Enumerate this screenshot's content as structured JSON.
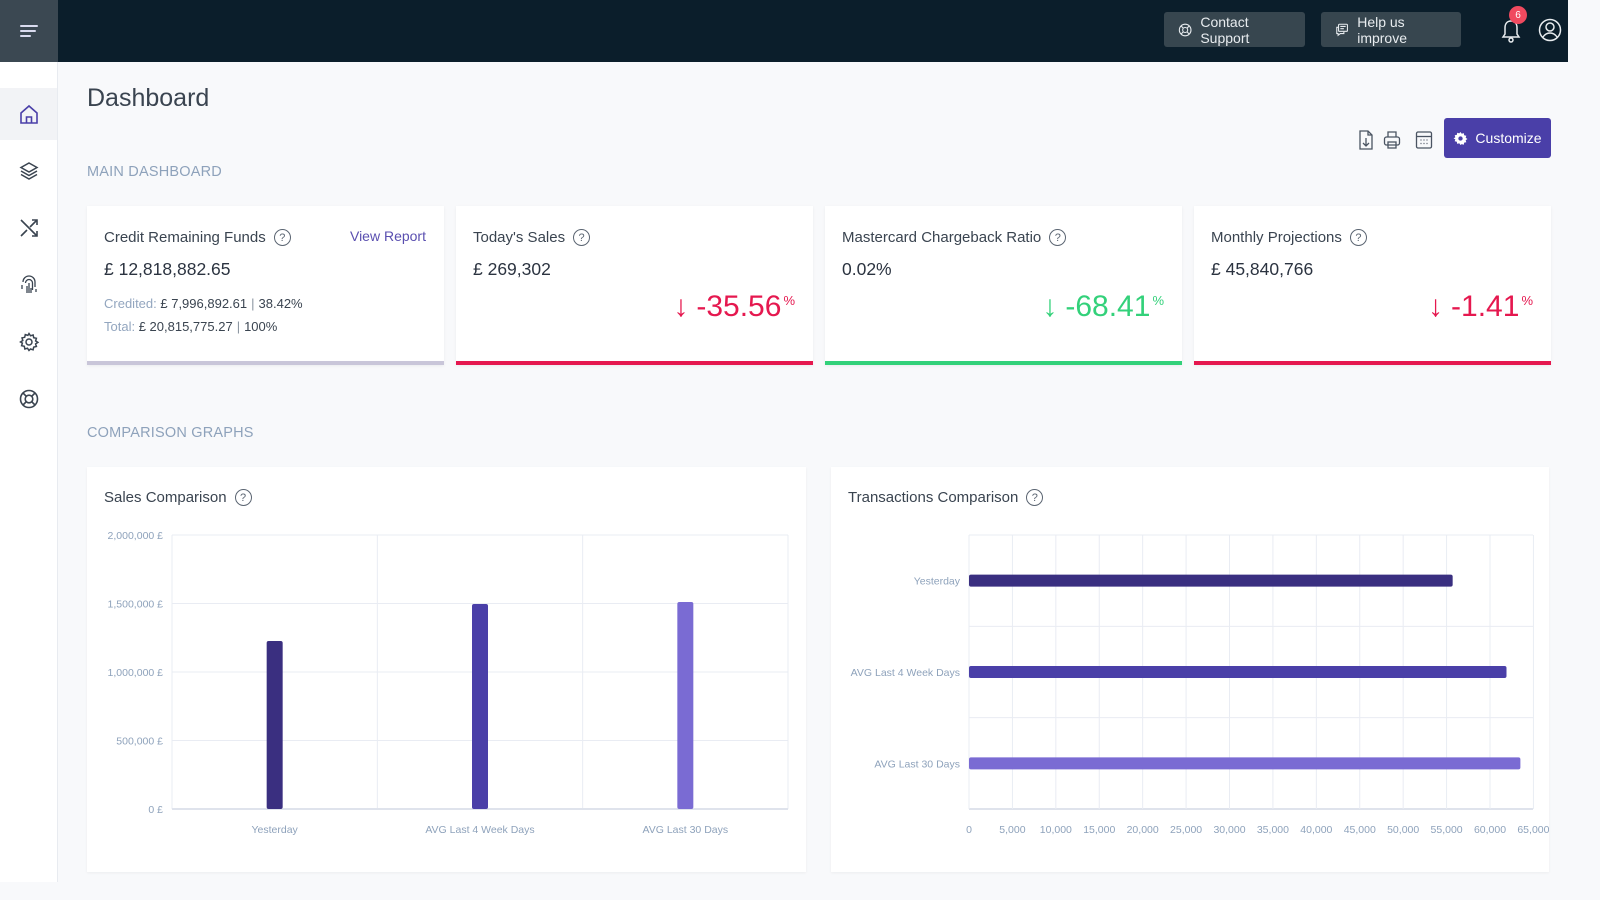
{
  "topbar": {
    "menu_icon": "hamburger-icon",
    "contact_support": "Contact Support",
    "help_improve": "Help us improve",
    "notifications_count": "6"
  },
  "sidebar": {
    "items": [
      {
        "name": "home",
        "icon": "home-icon",
        "active": true
      },
      {
        "name": "layers",
        "icon": "layers-icon"
      },
      {
        "name": "transactions",
        "icon": "shuffle-icon"
      },
      {
        "name": "security",
        "icon": "fingerprint-icon"
      },
      {
        "name": "settings",
        "icon": "gear-icon"
      },
      {
        "name": "support",
        "icon": "lifebuoy-icon"
      }
    ]
  },
  "page": {
    "title": "Dashboard",
    "main_section": "MAIN DASHBOARD",
    "comparison_section": "COMPARISON GRAPHS",
    "customize": "Customize"
  },
  "colors": {
    "accent": "#4a3fa8",
    "negative": "#e5184f",
    "positive": "#33d17a",
    "neutral_bar": "#c9c6d9"
  },
  "kpis": [
    {
      "title": "Credit Remaining Funds",
      "value": "£ 12,818,882.65",
      "link": "View Report",
      "credited_label": "Credited:",
      "credited_value": "£ 7,996,892.61",
      "credited_pct": "38.42%",
      "total_label": "Total:",
      "total_value": "£ 20,815,775.27",
      "total_pct": "100%"
    },
    {
      "title": "Today's Sales",
      "value": "£ 269,302",
      "delta": "-35.56",
      "delta_unit": "%",
      "arrow": "↓",
      "status": "negative"
    },
    {
      "title": "Mastercard Chargeback Ratio",
      "value": "0.02%",
      "delta": "-68.41",
      "delta_unit": "%",
      "arrow": "↓",
      "status": "positive"
    },
    {
      "title": "Monthly Projections",
      "value": "£ 45,840,766",
      "delta": "-1.41",
      "delta_unit": "%",
      "arrow": "↓",
      "status": "negative"
    }
  ],
  "chart_data": [
    {
      "type": "bar",
      "title": "Sales Comparison",
      "orientation": "vertical",
      "categories": [
        "Yesterday",
        "AVG Last 4 Week Days",
        "AVG Last 30 Days"
      ],
      "values": [
        1226000,
        1496000,
        1511000
      ],
      "colors": [
        "#3a2f80",
        "#4a3fa8",
        "#7a6bd3"
      ],
      "yticks": [
        "0 £",
        "500,000 £",
        "1,000,000 £",
        "1,500,000 £",
        "2,000,000 £"
      ],
      "ylim": [
        0,
        2000000
      ],
      "grid": true
    },
    {
      "type": "bar",
      "title": "Transactions Comparison",
      "orientation": "horizontal",
      "categories": [
        "Yesterday",
        "AVG Last 4 Week Days",
        "AVG Last 30 Days"
      ],
      "values": [
        55700,
        61900,
        63500
      ],
      "colors": [
        "#3a2f80",
        "#4a3fa8",
        "#7a6bd3"
      ],
      "xticks": [
        "0",
        "5,000",
        "10,000",
        "15,000",
        "20,000",
        "25,000",
        "30,000",
        "35,000",
        "40,000",
        "45,000",
        "50,000",
        "55,000",
        "60,000",
        "65,000"
      ],
      "xlim": [
        0,
        65000
      ],
      "grid": true
    }
  ]
}
